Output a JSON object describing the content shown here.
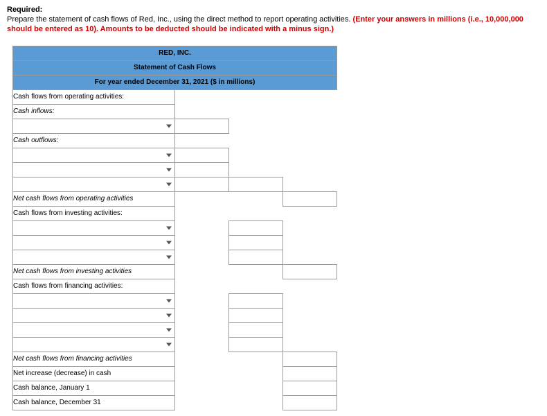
{
  "heading": "Required:",
  "instruction_plain": "Prepare the statement of cash flows of Red, Inc., using the direct method to report operating activities. ",
  "instruction_red": "(Enter your answers in millions (i.e., 10,000,000 should be entered as 10). Amounts to be deducted should be indicated with a minus sign.)",
  "table": {
    "title1": "RED, INC.",
    "title2": "Statement of Cash Flows",
    "title3": "For year ended December 31, 2021 ($ in millions)",
    "rows": {
      "op_header": "Cash flows from operating activities:",
      "cash_inflows": "Cash inflows:",
      "cash_outflows": "Cash outflows:",
      "net_op": "Net cash flows from operating activities",
      "inv_header": "Cash flows from investing activities:",
      "net_inv": "Net cash flows from investing activities",
      "fin_header": "Cash flows from financing activities:",
      "net_fin": "Net cash flows from financing activities",
      "net_incr": "Net increase (decrease) in cash",
      "bal_jan": "Cash balance, January 1",
      "bal_dec": "Cash balance, December 31"
    }
  }
}
